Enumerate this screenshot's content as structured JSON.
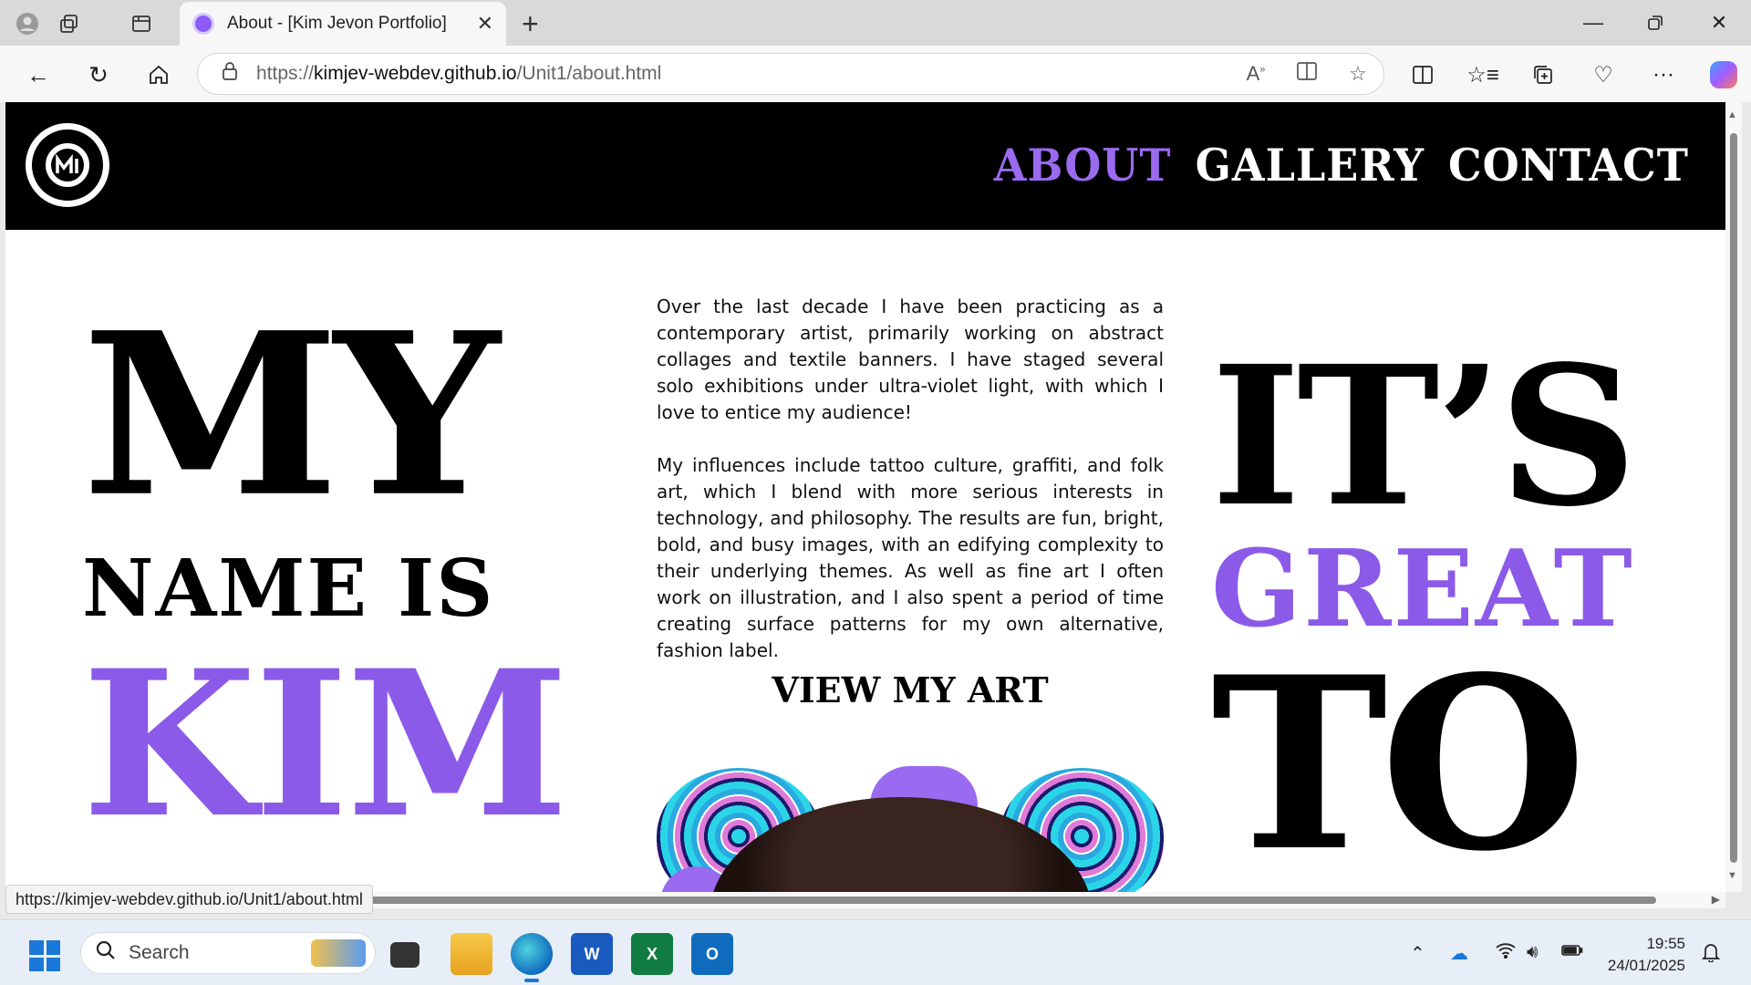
{
  "browser": {
    "tab_title": "About - [Kim Jevon Portfolio]",
    "url_prefix": "https://",
    "url_host": "kimjev-webdev.github.io",
    "url_path": "/Unit1/about.html",
    "icons": {
      "profile": "profile-icon",
      "workspaces": "workspaces-icon",
      "tab_actions": "tab-actions-icon",
      "close_tab": "close-icon",
      "new_tab": "plus-icon",
      "back": "back-arrow-icon",
      "refresh": "refresh-icon",
      "home": "home-icon",
      "lock": "lock-icon",
      "read_aloud": "read-aloud-icon",
      "immersive_reader": "immersive-reader-icon",
      "favorite": "star-icon",
      "split": "split-screen-icon",
      "favorites": "favorites-icon",
      "collections": "collections-icon",
      "browser_essentials": "heartbeat-icon",
      "more": "more-icon",
      "copilot": "copilot-icon"
    }
  },
  "site": {
    "nav": [
      "ABOUT",
      "GALLERY",
      "CONTACT"
    ],
    "active_nav": "ABOUT",
    "left_heading": {
      "line1": "MY",
      "line2": "NAME IS",
      "line3": "KIM"
    },
    "right_heading": {
      "line1": "IT’S",
      "line2": "GREAT",
      "line3": "TO"
    },
    "bio": [
      "Over the last decade I have been practicing as a contemporary artist, primarily working on abstract collages and textile banners. I have staged several solo exhibitions under ultra-violet light, with which I love to entice my audience!",
      "My influences include tattoo culture, graffiti, and folk art, which I blend with more serious interests in technology, and philosophy. The results are fun, bright, bold, and busy images, with an edifying complexity to their underlying themes. As well as fine art I often work on illustration, and I also spent a period of time creating surface patterns for my own alternative, fashion label."
    ],
    "cta": "VIEW MY ART",
    "colors": {
      "accent": "#8b5ae8",
      "header_bg": "#000000"
    }
  },
  "status_bar": {
    "link": "https://kimjev-webdev.github.io/Unit1/about.html"
  },
  "taskbar": {
    "search_placeholder": "Search",
    "apps": [
      "File Explorer",
      "Microsoft Edge",
      "Word",
      "Excel",
      "Outlook"
    ],
    "app_letters": {
      "word": "W",
      "excel": "X",
      "outlook": "O"
    },
    "time": "19:55",
    "date": "24/01/2025"
  }
}
